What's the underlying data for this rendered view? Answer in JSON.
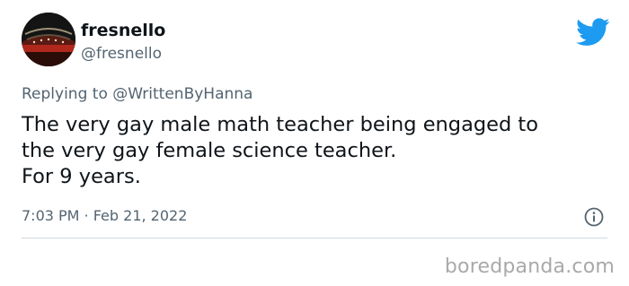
{
  "tweet": {
    "display_name": "fresnello",
    "handle": "@fresnello",
    "reply_prefix": "Replying to",
    "reply_to": "@WrittenByHanna",
    "text_lines": [
      "The very gay male math teacher being engaged to",
      "the very gay female science teacher.",
      "For 9 years."
    ],
    "timestamp": "7:03 PM · Feb 21, 2022"
  },
  "icons": {
    "brand": "twitter-bird-icon",
    "info": "info-icon",
    "brand_color": "#1d9bf0"
  },
  "watermark": "boredpanda.com"
}
